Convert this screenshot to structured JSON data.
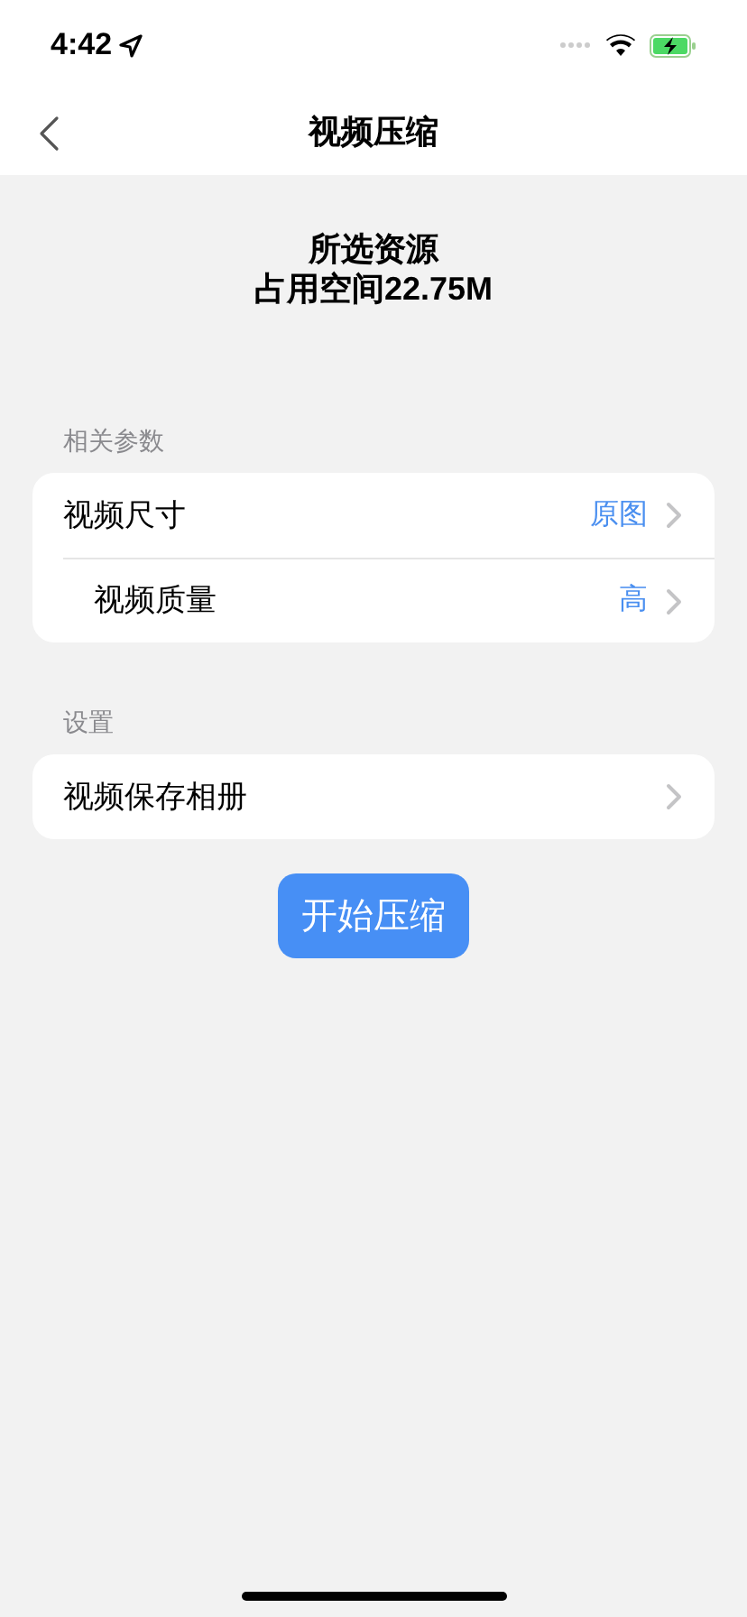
{
  "status_bar": {
    "time": "4:42"
  },
  "nav": {
    "title": "视频压缩"
  },
  "summary": {
    "line_1": "所选资源",
    "line_2": "占用空间22.75M"
  },
  "sections": [
    {
      "header": "相关参数",
      "rows": [
        {
          "label": "视频尺寸",
          "value": "原图"
        },
        {
          "label": "视频质量",
          "value": "高"
        }
      ]
    },
    {
      "header": "设置",
      "rows": [
        {
          "label": "视频保存相册"
        }
      ]
    }
  ],
  "start_button": "开始压缩"
}
